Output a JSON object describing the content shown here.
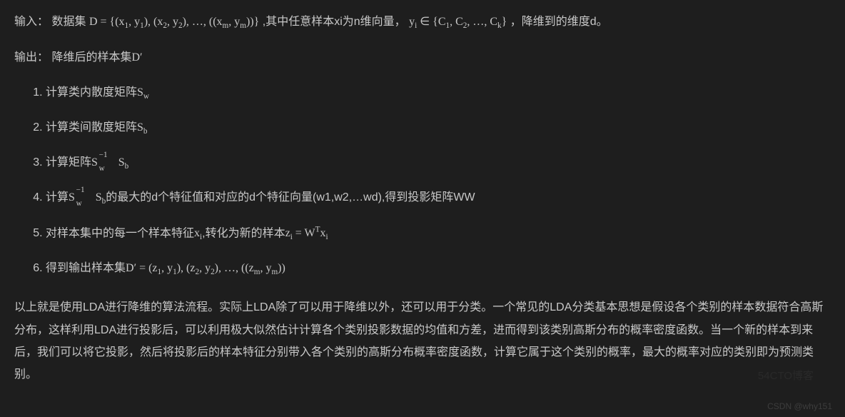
{
  "input": {
    "label": "输入：",
    "text_prefix": "数据集",
    "set_expr": "D = {(x₁, y₁), (x₂, y₂), …, ((xₘ, yₘ))}",
    "mid_text": ",其中任意样本xi为n维向量，",
    "y_expr": "yᵢ ∈ {C₁, C₂, …, Cₖ}",
    "tail_text": "，降维到的维度d。"
  },
  "output": {
    "label": "输出：",
    "text": "降维后的样本集D′"
  },
  "steps": [
    {
      "prefix": "计算类内散度矩阵",
      "math": "S",
      "msub": "w"
    },
    {
      "prefix": "计算类间散度矩阵",
      "math": "S",
      "msub": "b"
    },
    {
      "prefix": "计算矩阵",
      "expr": "Sw⁻¹Sb"
    },
    {
      "prefix": "计算",
      "expr": "Sw⁻¹Sb",
      "tail": "的最大的d个特征值和对应的d个特征向量(w1,w2,…wd),得到投影矩阵WW"
    },
    {
      "prefix": "对样本集中的每一个样本特征xᵢ,转化为新的样本",
      "expr2": "zᵢ = Wᵀxᵢ"
    },
    {
      "prefix": "得到输出样本集",
      "expr3": "D′ = (z₁, y₁), (z₂, y₂), …, ((zₘ, yₘ))"
    }
  ],
  "paragraph": "以上就是使用LDA进行降维的算法流程。实际上LDA除了可以用于降维以外，还可以用于分类。一个常见的LDA分类基本思想是假设各个类别的样本数据符合高斯分布，这样利用LDA进行投影后，可以利用极大似然估计计算各个类别投影数据的均值和方差，进而得到该类别高斯分布的概率密度函数。当一个新的样本到来后，我们可以将它投影，然后将投影后的样本特征分别带入各个类别的高斯分布概率密度函数，计算它属于这个类别的概率，最大的概率对应的类别即为预测类别。",
  "watermark1": "54CTO博客",
  "watermark2": "CSDN @why151"
}
